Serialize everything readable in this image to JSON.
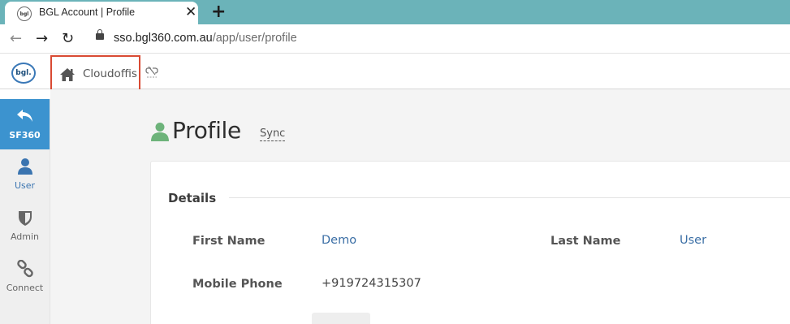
{
  "browser": {
    "tab_title": "BGL Account | Profile",
    "favicon_text": "bgl",
    "close_glyph": "✕",
    "new_tab_glyph": "+",
    "url_host": "sso.bgl360.com.au",
    "url_path": "/app/user/profile"
  },
  "header": {
    "logo_text": "bgl.",
    "breadcrumb_label": "Cloudoffis",
    "home_icon": "home-icon",
    "unlink_icon": "unlink-icon"
  },
  "sidebar": {
    "items": [
      {
        "label": "SF360",
        "icon": "back-arrow-icon",
        "active": true
      },
      {
        "label": "User",
        "icon": "user-icon",
        "active": false
      },
      {
        "label": "Admin",
        "icon": "shield-icon",
        "active": false
      },
      {
        "label": "Connect",
        "icon": "link-icon",
        "active": false
      }
    ]
  },
  "page": {
    "title": "Profile",
    "sync_label": "Sync",
    "section_title": "Details",
    "fields": {
      "first_name_label": "First Name",
      "first_name_value": "Demo",
      "last_name_label": "Last Name",
      "last_name_value": "User",
      "mobile_label": "Mobile Phone",
      "mobile_value": "+919724315307"
    }
  },
  "colors": {
    "tabstrip": "#6bb3b9",
    "sidebar_active": "#3c93cf",
    "link_blue": "#3a6ea5",
    "highlight_border": "#d94a33",
    "profile_icon": "#6db37a"
  }
}
